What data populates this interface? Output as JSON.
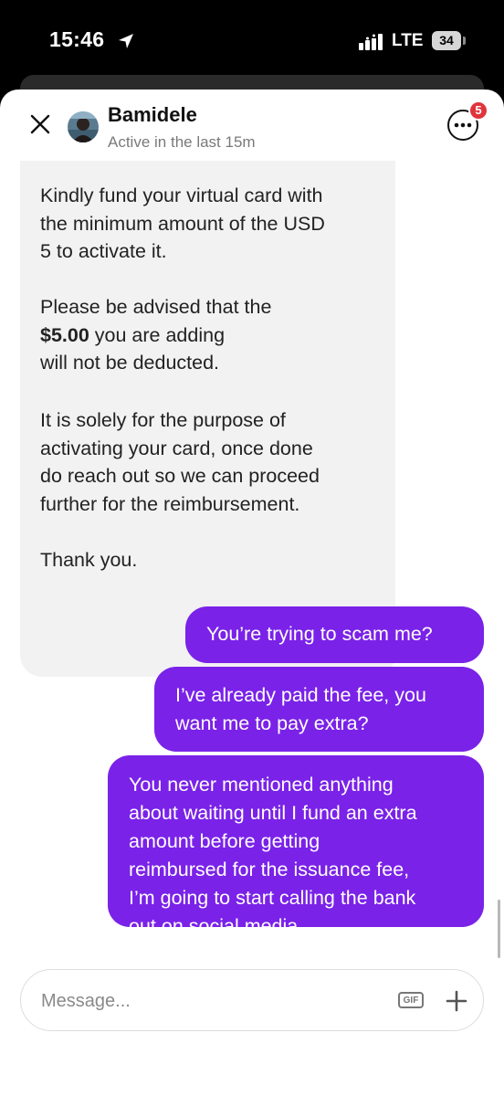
{
  "status_bar": {
    "time": "15:46",
    "network": "LTE",
    "battery": "34"
  },
  "header": {
    "contact_name": "Bamidele",
    "contact_status": "Active in the last 15m",
    "notification_count": "5"
  },
  "messages": {
    "incoming": {
      "lines_1": [
        "Kindly fund your virtual card with",
        "the minimum amount of the USD",
        "5 to activate it."
      ],
      "p2_line1": "Please be advised that the",
      "p2_amount": "$5.00",
      "p2_line2_rest": " you are adding",
      "p2_line3": "will not be deducted.",
      "lines_3": [
        "It is solely for the purpose of",
        "activating your card, once done",
        "do reach out so we can proceed",
        "further for the reimbursement."
      ],
      "closing": "Thank you."
    },
    "outgoing": [
      {
        "lines": [
          "You’re trying to scam me?"
        ]
      },
      {
        "lines": [
          "I’ve already paid the fee, you",
          "want me to pay extra?"
        ]
      },
      {
        "lines": [
          "You never mentioned anything",
          "about waiting until I fund an extra",
          "amount before getting",
          "reimbursed for the issuance fee,",
          "I’m going to start calling the bank",
          "out on social media"
        ]
      }
    ]
  },
  "composer": {
    "placeholder": "Message...",
    "value": "",
    "gif_label": "GIF"
  },
  "colors": {
    "outgoing_bubble": "#7a22e8",
    "incoming_bubble": "#f2f2f2",
    "badge": "#e0343b"
  },
  "icons": [
    "location-arrow-icon",
    "signal-icon",
    "battery-icon",
    "close-icon",
    "more-options-icon",
    "gif-icon",
    "plus-icon"
  ]
}
